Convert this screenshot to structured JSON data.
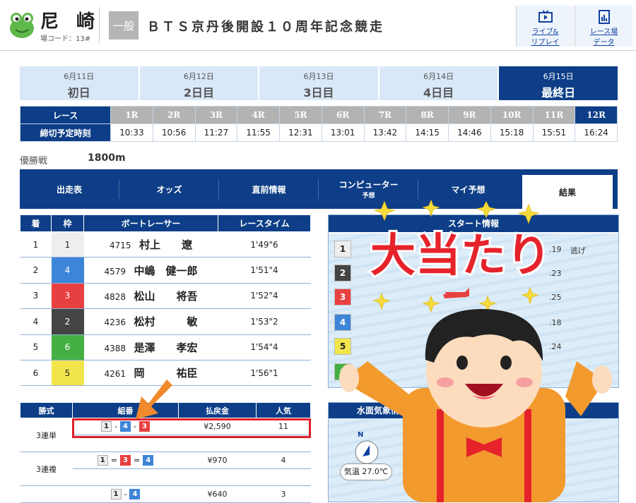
{
  "header": {
    "venue_name": "尼 崎",
    "venue_code": "場コード：13#",
    "grade": "一般",
    "race_title": "ＢＴＳ京丹後開設１０周年記念競走",
    "live_label_1": "ライブ&",
    "live_label_2": "リプレイ",
    "data_label_1": "レース場",
    "data_label_2": "データ"
  },
  "days": [
    {
      "date": "6月11日",
      "label": "初日"
    },
    {
      "date": "6月12日",
      "label": "2日目"
    },
    {
      "date": "6月13日",
      "label": "3日目"
    },
    {
      "date": "6月14日",
      "label": "4日目"
    },
    {
      "date": "6月15日",
      "label": "最終日"
    }
  ],
  "race_table": {
    "race_header": "レース",
    "time_header": "締切予定時刻",
    "races": [
      "1R",
      "2R",
      "3R",
      "4R",
      "5R",
      "6R",
      "7R",
      "8R",
      "9R",
      "10R",
      "11R",
      "12R"
    ],
    "times": [
      "10:33",
      "10:56",
      "11:27",
      "11:55",
      "12:31",
      "13:01",
      "13:42",
      "14:15",
      "14:46",
      "15:18",
      "15:51",
      "16:24"
    ]
  },
  "race_info": {
    "name": "優勝戦",
    "distance": "1800m"
  },
  "tabs": {
    "entry": "出走表",
    "odds": "オッズ",
    "pre_info": "直前情報",
    "computer_1": "コンピューター",
    "computer_2": "予想",
    "my_pred": "マイ予想",
    "result": "結果"
  },
  "results": {
    "headers": [
      "着",
      "枠",
      "ボートレーサー",
      "レースタイム"
    ],
    "rows": [
      {
        "pos": "1",
        "lane": "1",
        "id": "4715",
        "name": "村上　　遼",
        "time": "1'49\"6"
      },
      {
        "pos": "2",
        "lane": "4",
        "id": "4579",
        "name": "中嶋　健一郎",
        "time": "1'51\"4"
      },
      {
        "pos": "3",
        "lane": "3",
        "id": "4828",
        "name": "松山　　将吾",
        "time": "1'52\"4"
      },
      {
        "pos": "4",
        "lane": "2",
        "id": "4236",
        "name": "松村　　　敏",
        "time": "1'53\"2"
      },
      {
        "pos": "5",
        "lane": "6",
        "id": "4388",
        "name": "是澤　　孝宏",
        "time": "1'54\"4"
      },
      {
        "pos": "6",
        "lane": "5",
        "id": "4261",
        "name": "岡　　　祐臣",
        "time": "1'56\"1"
      }
    ]
  },
  "start_info": {
    "title": "スタート情報",
    "rows": [
      {
        "lane": "1",
        "time": ".19",
        "note": "逃げ"
      },
      {
        "lane": "2",
        "time": ".23",
        "note": ""
      },
      {
        "lane": "3",
        "time": ".25",
        "note": ""
      },
      {
        "lane": "4",
        "time": ".18",
        "note": ""
      },
      {
        "lane": "5",
        "time": ".24",
        "note": ""
      },
      {
        "lane": "6",
        "time": "",
        "note": ""
      }
    ]
  },
  "payout": {
    "headers": [
      "勝式",
      "組番",
      "払戻金",
      "人気"
    ],
    "rows": [
      {
        "type": "3連単",
        "combo": [
          "1",
          "4",
          "3"
        ],
        "sep": [
          "-",
          "-"
        ],
        "amount": "¥2,590",
        "pop": "11"
      },
      {
        "type": "3連複",
        "combo": [
          "1",
          "3",
          "4"
        ],
        "sep": [
          "=",
          "="
        ],
        "amount": "¥970",
        "pop": "4"
      },
      {
        "type": "",
        "combo": [
          "1",
          "4"
        ],
        "sep": [
          "-"
        ],
        "amount": "¥640",
        "pop": "3"
      }
    ]
  },
  "water": {
    "title": "水面気象情報",
    "compass": "N",
    "temp": "気温 27.0℃"
  },
  "sticker": {
    "text": "大当たり"
  },
  "colors": {
    "navy": "#0d3e87",
    "highlight": "#e0202a",
    "arrow": "#f08a2a"
  }
}
